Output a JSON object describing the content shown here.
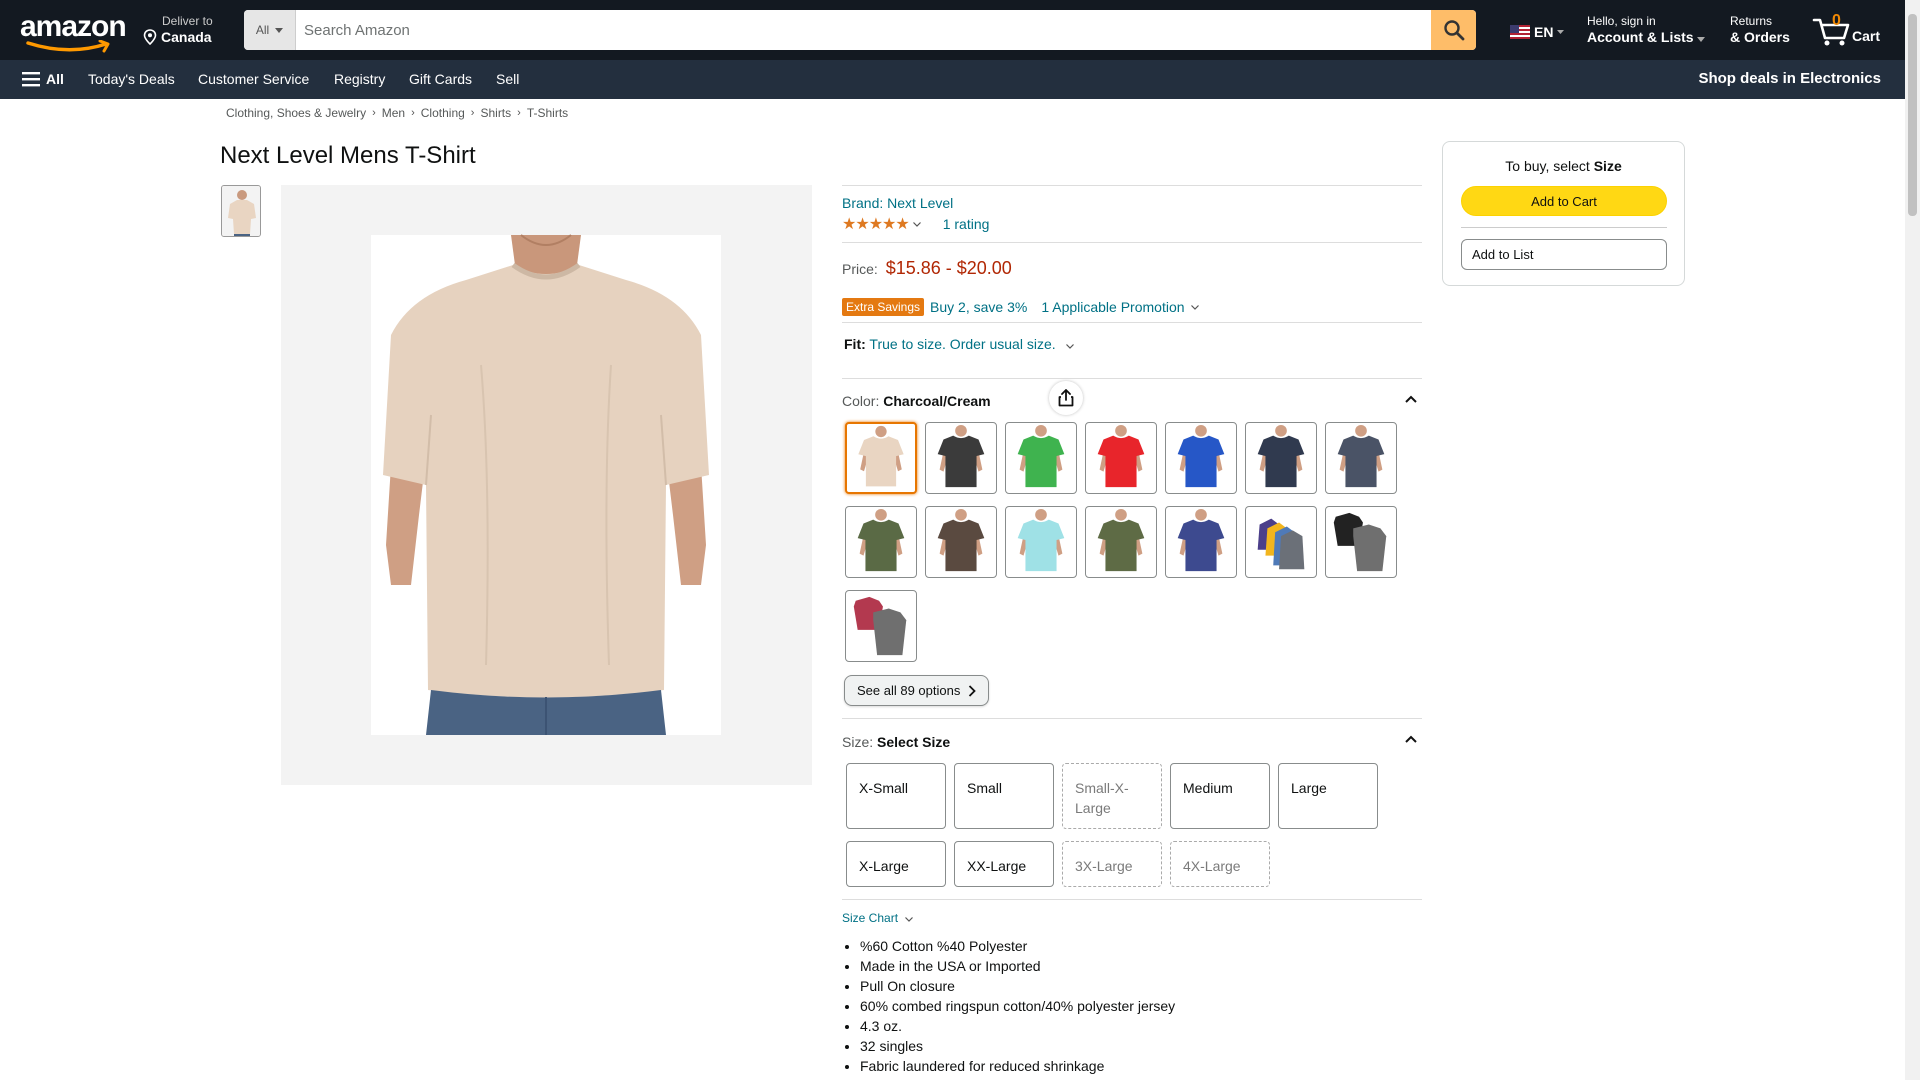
{
  "header": {
    "logo_text": "amazon",
    "deliver_line1": "Deliver to",
    "deliver_line2": "Canada",
    "search_category": "All",
    "search_placeholder": "Search Amazon",
    "lang": "EN",
    "account_line1": "Hello, sign in",
    "account_line2": "Account & Lists",
    "returns_line1": "Returns",
    "returns_line2": "& Orders",
    "cart_count": "0",
    "cart_label": "Cart"
  },
  "subnav": {
    "all": "All",
    "items": [
      "Today's Deals",
      "Customer Service",
      "Registry",
      "Gift Cards",
      "Sell"
    ],
    "right": "Shop deals in Electronics"
  },
  "breadcrumb": [
    "Clothing, Shoes & Jewelry",
    "Men",
    "Clothing",
    "Shirts",
    "T-Shirts"
  ],
  "product": {
    "title": "Next Level Mens T-Shirt",
    "brand": "Brand: Next Level",
    "stars": "★★★★★",
    "rating_count": "1 rating",
    "price_label": "Price:",
    "price_value": "$15.86 - $20.00",
    "promo_badge": "Extra Savings",
    "promo_text": "Buy 2, save 3%",
    "promo_link": "1 Applicable Promotion",
    "fit_key": "Fit:",
    "fit_value": "True to size. Order usual size.",
    "color_key": "Color:",
    "color_value": "Charcoal/Cream",
    "see_all": "See all 89 options",
    "size_key": "Size:",
    "size_value": "Select Size",
    "size_chart": "Size Chart",
    "sizes": [
      {
        "label": "X-Small",
        "available": true
      },
      {
        "label": "Small",
        "available": true
      },
      {
        "label": "Small-X-Large",
        "available": false
      },
      {
        "label": "Medium",
        "available": true
      },
      {
        "label": "Large",
        "available": true
      },
      {
        "label": "X-Large",
        "available": true
      },
      {
        "label": "XX-Large",
        "available": true
      },
      {
        "label": "3X-Large",
        "available": false
      },
      {
        "label": "4X-Large",
        "available": false
      }
    ],
    "bullets": [
      "%60 Cotton %40 Polyester",
      "Made in the USA or Imported",
      "Pull On closure",
      "60% combed ringspun cotton/40% polyester jersey",
      "4.3 oz.",
      "32 singles",
      "Fabric laundered for reduced shrinkage"
    ],
    "swatch_colors": [
      "#e9d5c2",
      "#3b3b3b",
      "#3fb34f",
      "#e8252b",
      "#2657c7",
      "#303a4f",
      "#4a5366",
      "#5a6a45",
      "#5a4a40",
      "#9fe1e6",
      "#5e6b45",
      "#3d4a8f",
      "#f2b51d",
      "#222222",
      "#b3394f"
    ]
  },
  "buybox": {
    "head_prefix": "To buy, select ",
    "head_bold": "Size",
    "add_to_cart": "Add to Cart",
    "add_to_list": "Add to List"
  },
  "colors": {
    "nav_bg": "#131921",
    "subnav_bg": "#232f3e",
    "link": "#007185",
    "price": "#b12704",
    "cart_button": "#ffd814",
    "search_button": "#febd69",
    "accent_orange": "#e77600"
  }
}
